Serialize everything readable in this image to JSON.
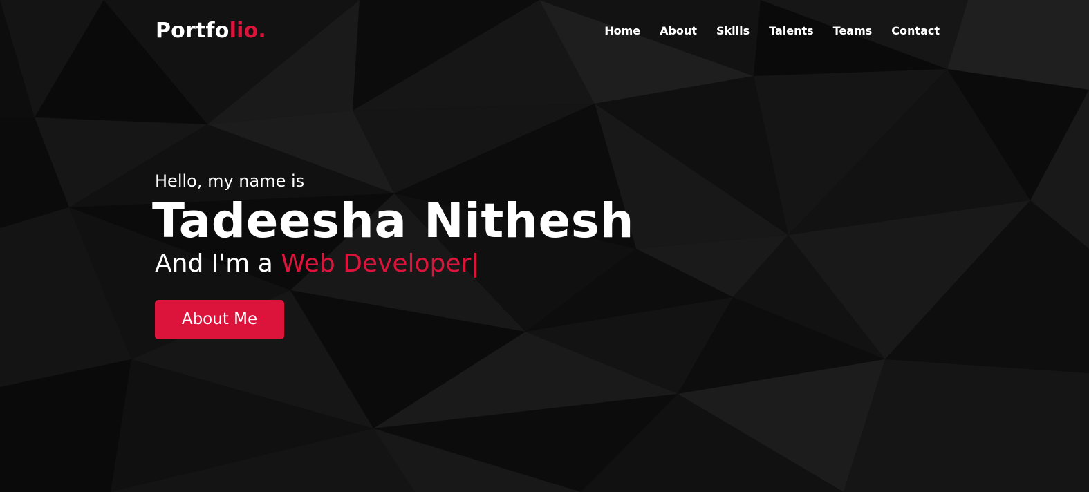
{
  "brand": {
    "logo_main": "Portfo",
    "logo_accent": "lio."
  },
  "nav": {
    "items": [
      {
        "label": "Home"
      },
      {
        "label": "About"
      },
      {
        "label": "Skills"
      },
      {
        "label": "Talents"
      },
      {
        "label": "Teams"
      },
      {
        "label": "Contact"
      }
    ]
  },
  "hero": {
    "greeting": "Hello, my name is",
    "name": "Tadeesha Nithesh",
    "role_prefix": "And I'm a ",
    "role_typed": "Web Developer",
    "cursor": "|",
    "button_label": "About Me"
  },
  "colors": {
    "accent": "#dc143c",
    "background": "#0b0b0b",
    "text": "#ffffff"
  },
  "icons": {
    "background": "dark-low-poly-pattern"
  }
}
